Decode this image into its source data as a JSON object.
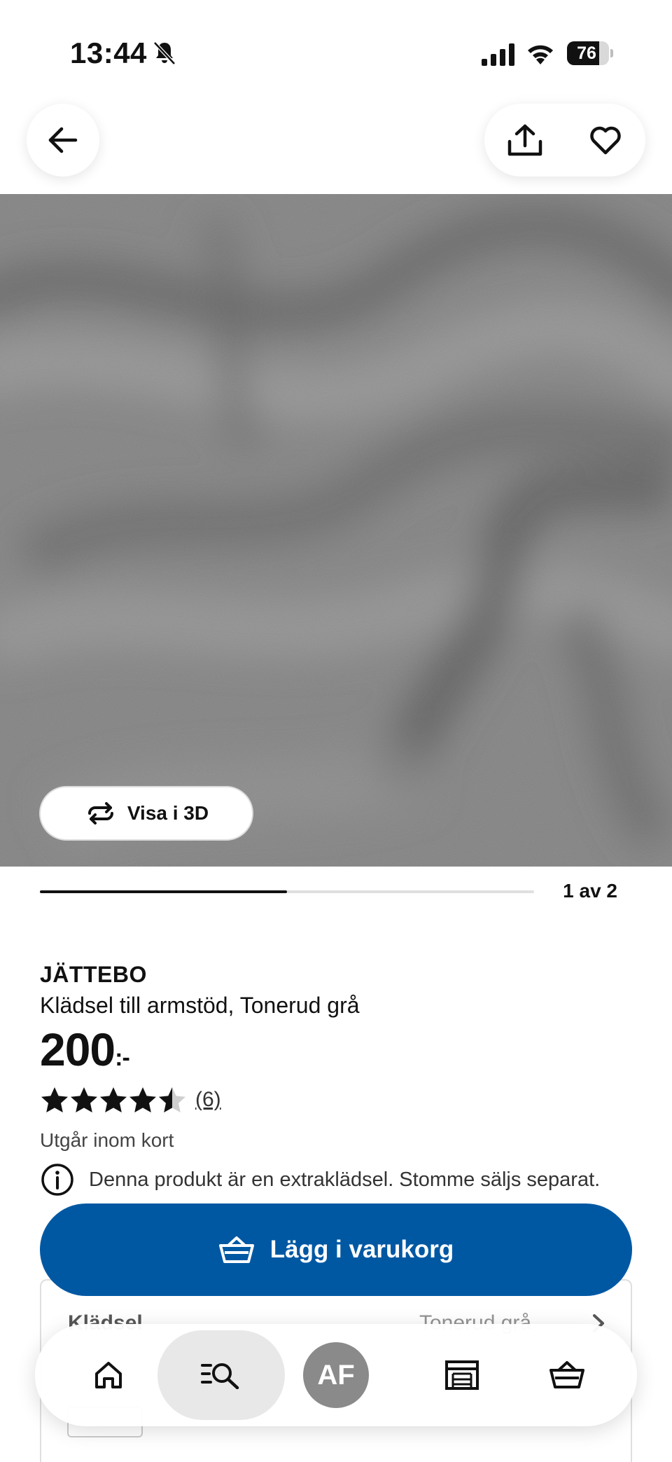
{
  "status_bar": {
    "time": "13:44",
    "battery_level": "76",
    "battery_fraction": 0.76
  },
  "header": {
    "back_icon": "arrow-left-icon",
    "share_icon": "share-icon",
    "favorite_icon": "heart-outline-icon"
  },
  "gallery": {
    "view_3d_label": "Visa i 3D",
    "pager_label": "1 av 2",
    "current": 1,
    "total": 2
  },
  "product": {
    "brand": "JÄTTEBO",
    "description": "Klädsel till armstöd, Tonerud grå",
    "price": "200",
    "price_suffix": ":-",
    "rating": 4.5,
    "rating_max": 5,
    "review_count": "(6)",
    "stock_status": "Utgår inom kort",
    "info_note": "Denna produkt är en extraklädsel. Stomme säljs separat."
  },
  "actions": {
    "add_to_cart_label": "Lägg i varukorg"
  },
  "variant": {
    "title": "Klädsel",
    "value": "Tonerud grå"
  },
  "bottom_nav": {
    "avatar_initials": "AF",
    "items": [
      "home-icon",
      "search-list-icon",
      "avatar",
      "store-icon",
      "cart-icon"
    ]
  },
  "colors": {
    "primary_blue": "#0058a3",
    "fabric_gray": "#8b8b8b",
    "avatar_gray": "#8a8a8a"
  }
}
